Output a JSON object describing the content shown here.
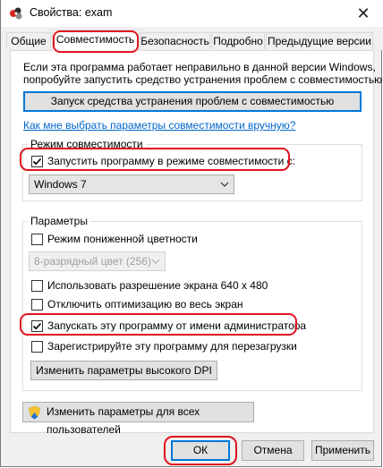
{
  "window": {
    "title": "Свойства: exam",
    "close_glyph": "✕"
  },
  "tabs": [
    {
      "label": "Общие"
    },
    {
      "label": "Совместимость"
    },
    {
      "label": "Безопасность"
    },
    {
      "label": "Подробно"
    },
    {
      "label": "Предыдущие версии"
    }
  ],
  "active_tab": "Совместимость",
  "intro": {
    "line1": "Если эта программа работает неправильно в данной версии Windows,",
    "line2": "попробуйте запустить средство устранения проблем с совместимостью."
  },
  "troubleshooter_button": "Запуск средства устранения проблем с совместимостью",
  "manual_link": "Как мне выбрать параметры совместимости вручную?",
  "compat_mode": {
    "group_title": "Режим совместимости",
    "checkbox_label": "Запустить программу в режиме совместимости с:",
    "checked": true,
    "selected_os": "Windows 7"
  },
  "settings": {
    "group_title": "Параметры",
    "reduced_color": {
      "label": "Режим пониженной цветности",
      "checked": false
    },
    "color_select": "8-разрядный цвет (256)",
    "resolution_640": {
      "label": "Использовать разрешение экрана 640 x 480",
      "checked": false
    },
    "disable_fullscreen_opt": {
      "label": "Отключить оптимизацию во весь экран",
      "checked": false
    },
    "run_as_admin": {
      "label": "Запускать эту программу от имени администратора",
      "checked": true
    },
    "register_restart": {
      "label": "Зарегистрируйте эту программу для перезагрузки",
      "checked": false
    },
    "dpi_button": "Изменить параметры высокого DPI"
  },
  "all_users_button": "Изменить параметры для всех пользователей",
  "footer": {
    "ok": "ОК",
    "cancel": "Отмена",
    "apply": "Применить"
  },
  "colors": {
    "highlight_ring": "#e0131f",
    "link": "#0066cc",
    "focus_border": "#0078d7"
  }
}
